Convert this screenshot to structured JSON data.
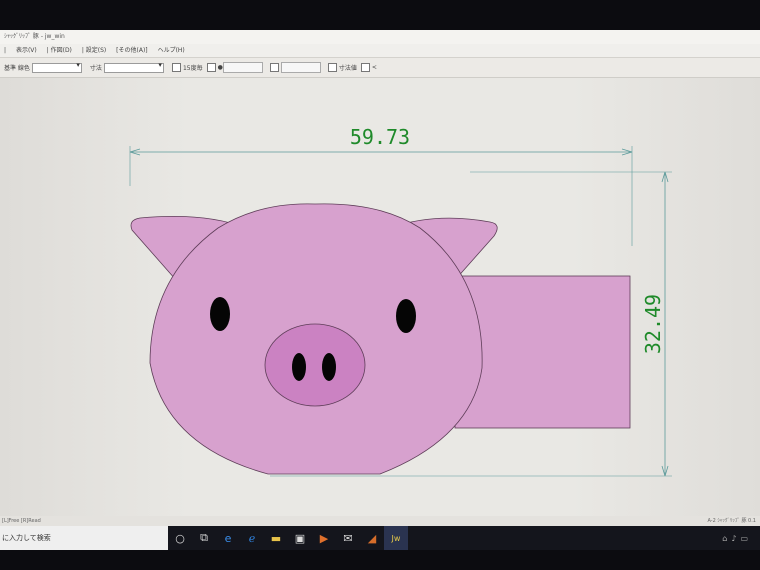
{
  "window": {
    "title": "ｼｬｯｸﾞﾘｯﾌﾟ 豚 - jw_win"
  },
  "menu": {
    "items": [
      "|",
      "表示(V)",
      "| 作図(D)",
      "| 設定(S)",
      "[その他(A)]",
      "ヘルプ(H)"
    ]
  },
  "toolbar": {
    "label_1": "基準 線色",
    "label_2": "寸法",
    "check_1_label": "15度毎",
    "check_2_label": "寸法値",
    "last_label": "<"
  },
  "drawing": {
    "width_dimension": "59.73",
    "height_dimension": "32.49",
    "colors": {
      "pig_body": "#d7a1ce",
      "pig_outline": "#5e3d58",
      "nose": "#cb82c2",
      "eyes": "#050505",
      "dimension_text": "#1f8a2a",
      "dimension_line": "#5b9a9a"
    }
  },
  "statusbar": {
    "left_text": "[L]Free [R]Read",
    "right_text": "A-2 ｼｬｯｸﾞﾘｯﾌﾟ 豚 0.1"
  },
  "taskbar": {
    "search_placeholder": "に入力して検索",
    "icons": [
      "cortana-circle-icon",
      "task-view-icon",
      "edge-icon",
      "ie-icon",
      "file-explorer-icon",
      "store-icon",
      "media-icon",
      "mail-icon",
      "app-icon",
      "jww-icon"
    ],
    "tray_icons": [
      "network-icon",
      "volume-icon",
      "battery-icon"
    ]
  }
}
